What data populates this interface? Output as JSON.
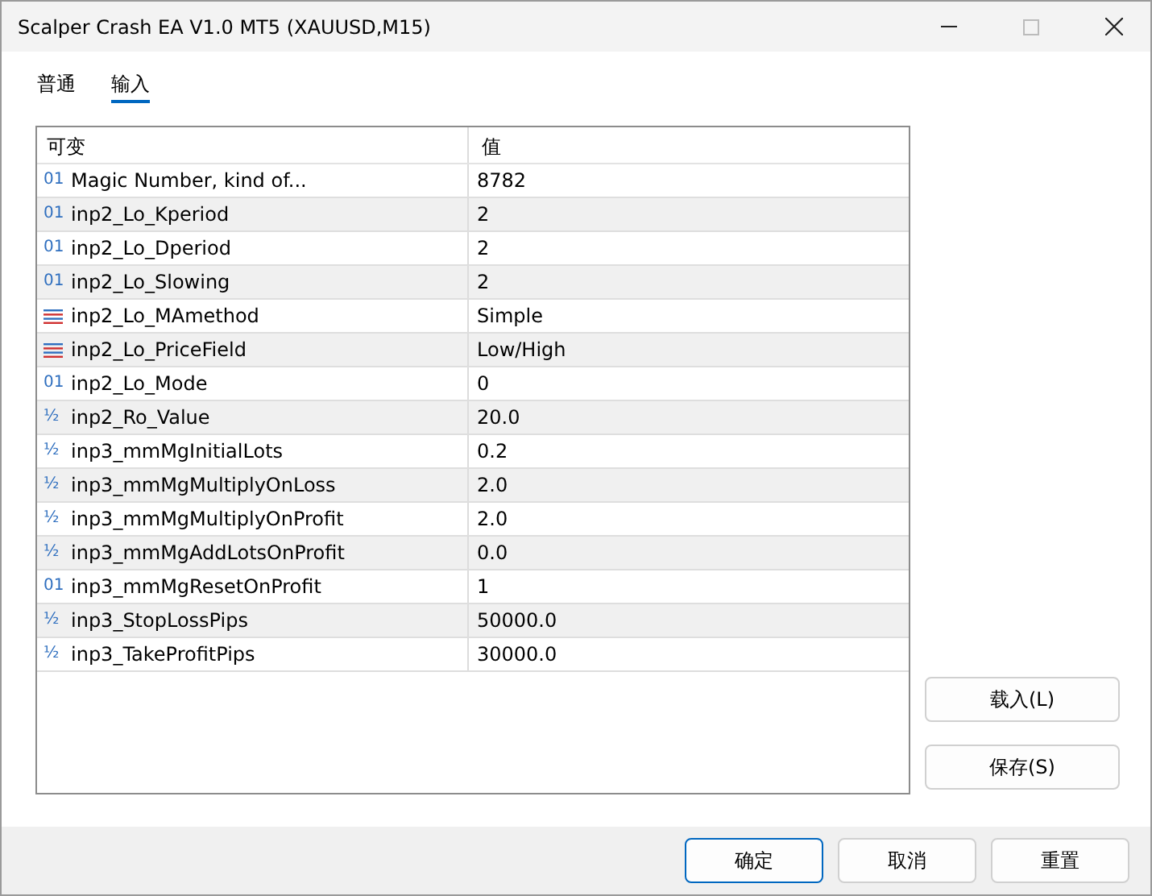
{
  "window": {
    "title": "Scalper Crash EA V1.0 MT5 (XAUUSD,M15)"
  },
  "tabs": [
    {
      "label": "普通",
      "selected": false
    },
    {
      "label": "输入",
      "selected": true
    }
  ],
  "table": {
    "columns": [
      "可变",
      "值"
    ],
    "rows": [
      {
        "kind": "int",
        "mark": "01",
        "name": "Magic Number, kind of...",
        "value": "8782"
      },
      {
        "kind": "int",
        "mark": "01",
        "name": "inp2_Lo_Kperiod",
        "value": "2"
      },
      {
        "kind": "int",
        "mark": "01",
        "name": "inp2_Lo_Dperiod",
        "value": "2"
      },
      {
        "kind": "int",
        "mark": "01",
        "name": "inp2_Lo_Slowing",
        "value": "2"
      },
      {
        "kind": "enum",
        "name": "inp2_Lo_MAmethod",
        "value": "Simple"
      },
      {
        "kind": "enum",
        "name": "inp2_Lo_PriceField",
        "value": "Low/High"
      },
      {
        "kind": "int",
        "mark": "01",
        "name": "inp2_Lo_Mode",
        "value": "0"
      },
      {
        "kind": "double",
        "mark": "½",
        "name": "inp2_Ro_Value",
        "value": "20.0"
      },
      {
        "kind": "double",
        "mark": "½",
        "name": "inp3_mmMgInitialLots",
        "value": "0.2"
      },
      {
        "kind": "double",
        "mark": "½",
        "name": "inp3_mmMgMultiplyOnLoss",
        "value": "2.0"
      },
      {
        "kind": "double",
        "mark": "½",
        "name": "inp3_mmMgMultiplyOnProfit",
        "value": "2.0"
      },
      {
        "kind": "double",
        "mark": "½",
        "name": "inp3_mmMgAddLotsOnProfit",
        "value": "0.0"
      },
      {
        "kind": "int",
        "mark": "01",
        "name": "inp3_mmMgResetOnProfit",
        "value": "1"
      },
      {
        "kind": "double",
        "mark": "½",
        "name": "inp3_StopLossPips",
        "value": "50000.0"
      },
      {
        "kind": "double",
        "mark": "½",
        "name": "inp3_TakeProfitPips",
        "value": "30000.0"
      }
    ]
  },
  "side_buttons": [
    "载入(L)",
    "保存(S)"
  ],
  "footer_buttons": [
    {
      "label": "确定",
      "default": true
    },
    {
      "label": "取消",
      "default": false
    },
    {
      "label": "重置",
      "default": false
    }
  ]
}
